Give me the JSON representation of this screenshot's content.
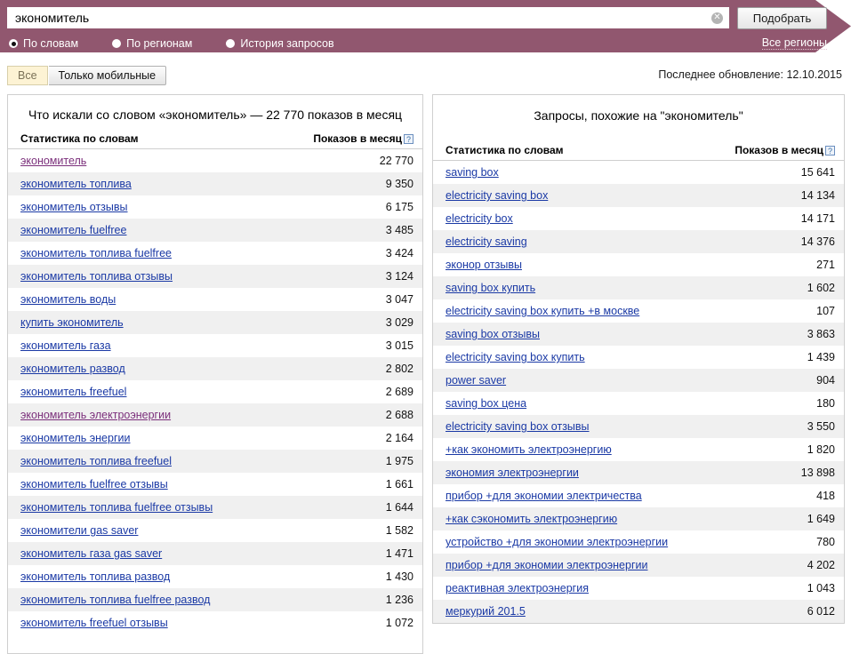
{
  "search": {
    "value": "экономитель",
    "placeholder": "",
    "clear_icon": "close-circle-icon",
    "submit_label": "Подобрать"
  },
  "modes": [
    {
      "label": "По словам",
      "selected": true
    },
    {
      "label": "По регионам",
      "selected": false
    },
    {
      "label": "История запросов",
      "selected": false
    }
  ],
  "all_regions_label": "Все регионы",
  "tabs": [
    {
      "label": "Все",
      "active": true
    },
    {
      "label": "Только мобильные",
      "active": false
    }
  ],
  "last_update": "Последнее обновление: 12.10.2015",
  "left_panel": {
    "title": "Что искали со словом «экономитель» — 22 770 показов в месяц",
    "col_phrase": "Статистика по словам",
    "col_count": "Показов в месяц",
    "help_icon": "question-mark-icon",
    "rows": [
      {
        "phrase": "экономитель",
        "count": "22 770",
        "visited": true
      },
      {
        "phrase": "экономитель топлива",
        "count": "9 350",
        "visited": false
      },
      {
        "phrase": "экономитель отзывы",
        "count": "6 175",
        "visited": false
      },
      {
        "phrase": "экономитель fuelfree",
        "count": "3 485",
        "visited": false
      },
      {
        "phrase": "экономитель топлива fuelfree",
        "count": "3 424",
        "visited": false
      },
      {
        "phrase": "экономитель топлива отзывы",
        "count": "3 124",
        "visited": false
      },
      {
        "phrase": "экономитель воды",
        "count": "3 047",
        "visited": false
      },
      {
        "phrase": "купить экономитель",
        "count": "3 029",
        "visited": false
      },
      {
        "phrase": "экономитель газа",
        "count": "3 015",
        "visited": false
      },
      {
        "phrase": "экономитель развод",
        "count": "2 802",
        "visited": false
      },
      {
        "phrase": "экономитель freefuel",
        "count": "2 689",
        "visited": false
      },
      {
        "phrase": "экономитель электроэнергии",
        "count": "2 688",
        "visited": true
      },
      {
        "phrase": "экономитель энергии",
        "count": "2 164",
        "visited": false
      },
      {
        "phrase": "экономитель топлива freefuel",
        "count": "1 975",
        "visited": false
      },
      {
        "phrase": "экономитель fuelfree отзывы",
        "count": "1 661",
        "visited": false
      },
      {
        "phrase": "экономитель топлива fuelfree отзывы",
        "count": "1 644",
        "visited": false
      },
      {
        "phrase": "экономители gas saver",
        "count": "1 582",
        "visited": false
      },
      {
        "phrase": "экономитель газа gas saver",
        "count": "1 471",
        "visited": false
      },
      {
        "phrase": "экономитель топлива развод",
        "count": "1 430",
        "visited": false
      },
      {
        "phrase": "экономитель топлива fuelfree развод",
        "count": "1 236",
        "visited": false
      },
      {
        "phrase": "экономитель freefuel отзывы",
        "count": "1 072",
        "visited": false
      }
    ]
  },
  "right_panel": {
    "title": "Запросы, похожие на \"экономитель\"",
    "col_phrase": "Статистика по словам",
    "col_count": "Показов в месяц",
    "help_icon": "question-mark-icon",
    "rows": [
      {
        "phrase": "saving box",
        "count": "15 641",
        "visited": false
      },
      {
        "phrase": "electricity saving box",
        "count": "14 134",
        "visited": false
      },
      {
        "phrase": "electricity box",
        "count": "14 171",
        "visited": false
      },
      {
        "phrase": "electricity saving",
        "count": "14 376",
        "visited": false
      },
      {
        "phrase": "эконор отзывы",
        "count": "271",
        "visited": false
      },
      {
        "phrase": "saving box купить",
        "count": "1 602",
        "visited": false
      },
      {
        "phrase": "electricity saving box купить +в москве",
        "count": "107",
        "visited": false
      },
      {
        "phrase": "saving box отзывы",
        "count": "3 863",
        "visited": false
      },
      {
        "phrase": "electricity saving box купить",
        "count": "1 439",
        "visited": false
      },
      {
        "phrase": "power saver",
        "count": "904",
        "visited": false
      },
      {
        "phrase": "saving box цена",
        "count": "180",
        "visited": false
      },
      {
        "phrase": "electricity saving box отзывы",
        "count": "3 550",
        "visited": false
      },
      {
        "phrase": "+как экономить электроэнергию",
        "count": "1 820",
        "visited": false
      },
      {
        "phrase": "экономия электроэнергии",
        "count": "13 898",
        "visited": false
      },
      {
        "phrase": "прибор +для экономии электричества",
        "count": "418",
        "visited": false
      },
      {
        "phrase": "+как сэкономить электроэнергию",
        "count": "1 649",
        "visited": false
      },
      {
        "phrase": "устройство +для экономии электроэнергии",
        "count": "780",
        "visited": false
      },
      {
        "phrase": "прибор +для экономии электроэнергии",
        "count": "4 202",
        "visited": false
      },
      {
        "phrase": "реактивная электроэнергия",
        "count": "1 043",
        "visited": false
      },
      {
        "phrase": "меркурий 201.5",
        "count": "6 012",
        "visited": false
      }
    ]
  },
  "colors": {
    "header_band": "#91576f",
    "link": "#1a39a5",
    "link_visited": "#7b2f7b",
    "row_alt": "#f0f0f0",
    "tab_active": "#fdf3d4"
  }
}
